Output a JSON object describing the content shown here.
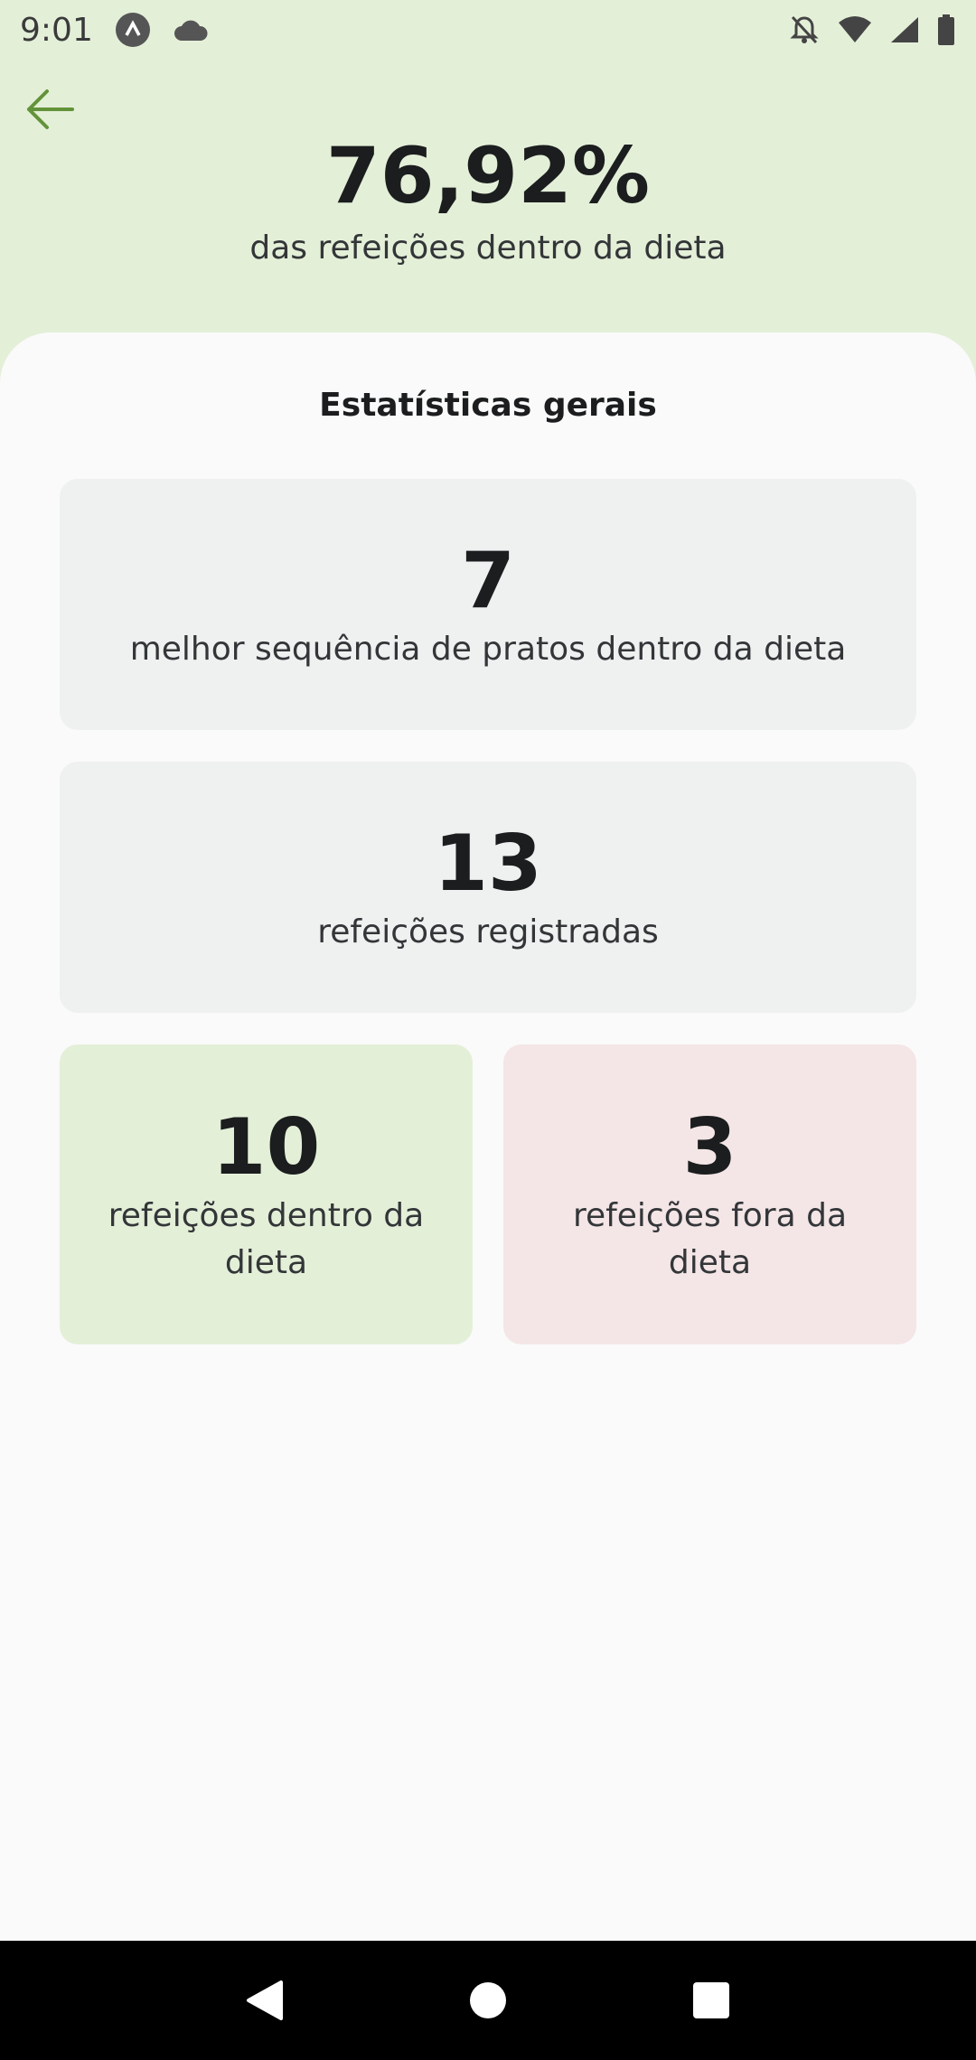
{
  "status_bar": {
    "time": "9:01",
    "icons": [
      "app-a-icon",
      "cloud-icon",
      "bell-off-icon",
      "wifi-icon",
      "signal-icon",
      "battery-icon"
    ]
  },
  "header": {
    "back_icon": "arrow-left-icon",
    "percent": "76,92%",
    "subtitle": "das refeições dentro da dieta",
    "accent_color": "#639339"
  },
  "stats": {
    "title": "Estatísticas gerais",
    "best_sequence": {
      "value": "7",
      "label": "melhor sequência de pratos dentro da dieta"
    },
    "total_meals": {
      "value": "13",
      "label": "refeições registradas"
    },
    "inside_diet": {
      "value": "10",
      "label": "refeições dentro da dieta",
      "color": "#E4EFD8"
    },
    "outside_diet": {
      "value": "3",
      "label": "refeições fora da dieta",
      "color": "#F4E5E6"
    }
  },
  "nav_bar": {
    "buttons": [
      "back-triangle-icon",
      "home-circle-icon",
      "recents-square-icon"
    ]
  }
}
